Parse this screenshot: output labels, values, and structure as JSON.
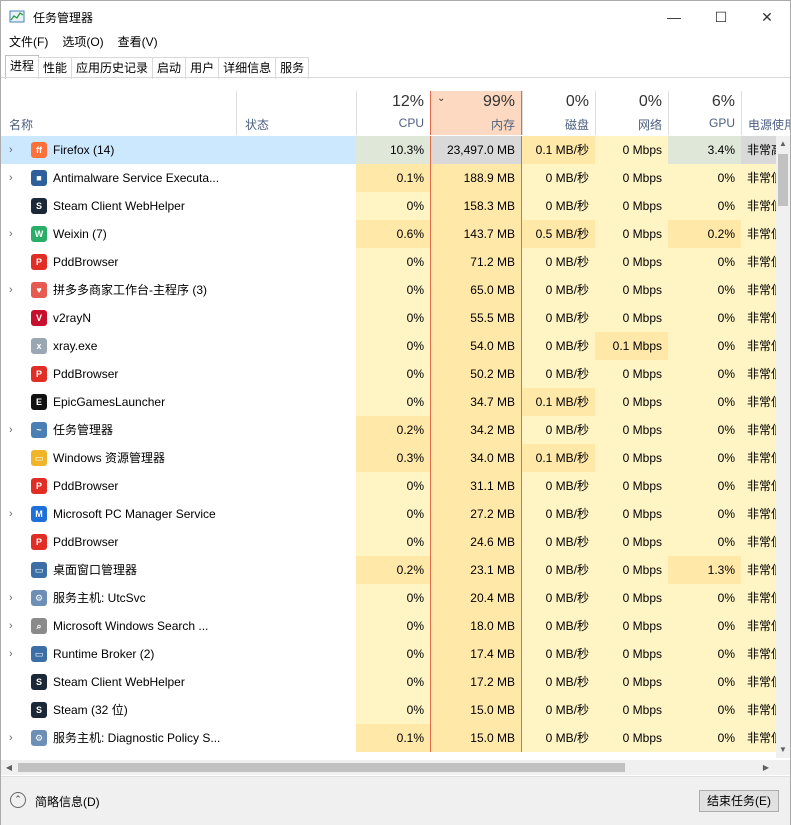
{
  "window": {
    "title": "任务管理器",
    "controls": {
      "minimize": "—",
      "maximize": "☐",
      "close": "✕"
    }
  },
  "menu": [
    "文件(F)",
    "选项(O)",
    "查看(V)"
  ],
  "tabs": [
    "进程",
    "性能",
    "应用历史记录",
    "启动",
    "用户",
    "详细信息",
    "服务"
  ],
  "header": {
    "name": "名称",
    "status": "状态",
    "cpu": {
      "pct": "12%",
      "label": "CPU"
    },
    "mem": {
      "pct": "99%",
      "label": "内存",
      "sort": "⌄"
    },
    "disk": {
      "pct": "0%",
      "label": "磁盘"
    },
    "net": {
      "pct": "0%",
      "label": "网络"
    },
    "gpu": {
      "pct": "6%",
      "label": "GPU"
    },
    "power": {
      "label": "电源使用"
    }
  },
  "processes": [
    {
      "name": "Firefox (14)",
      "expand": "›",
      "icon": "firefox-icon",
      "cpu": "10.3%",
      "mem": "23,497.0 MB",
      "disk": "0.1 MB/秒",
      "net": "0 Mbps",
      "gpu": "3.4%",
      "power": "非常高"
    },
    {
      "name": "Antimalware Service Executa...",
      "expand": "›",
      "icon": "antimalware-icon",
      "cpu": "0.1%",
      "mem": "188.9 MB",
      "disk": "0 MB/秒",
      "net": "0 Mbps",
      "gpu": "0%",
      "power": "非常低"
    },
    {
      "name": "Steam Client WebHelper",
      "expand": "",
      "icon": "steam-icon",
      "cpu": "0%",
      "mem": "158.3 MB",
      "disk": "0 MB/秒",
      "net": "0 Mbps",
      "gpu": "0%",
      "power": "非常低"
    },
    {
      "name": "Weixin (7)",
      "expand": "›",
      "icon": "weixin-icon",
      "cpu": "0.6%",
      "mem": "143.7 MB",
      "disk": "0.5 MB/秒",
      "net": "0 Mbps",
      "gpu": "0.2%",
      "power": "非常低"
    },
    {
      "name": "PddBrowser",
      "expand": "",
      "icon": "pddbrowser-icon",
      "cpu": "0%",
      "mem": "71.2 MB",
      "disk": "0 MB/秒",
      "net": "0 Mbps",
      "gpu": "0%",
      "power": "非常低"
    },
    {
      "name": "拼多多商家工作台-主程序 (3)",
      "expand": "›",
      "icon": "pdd-merchant-icon",
      "cpu": "0%",
      "mem": "65.0 MB",
      "disk": "0 MB/秒",
      "net": "0 Mbps",
      "gpu": "0%",
      "power": "非常低"
    },
    {
      "name": "v2rayN",
      "expand": "",
      "icon": "v2rayn-icon",
      "cpu": "0%",
      "mem": "55.5 MB",
      "disk": "0 MB/秒",
      "net": "0 Mbps",
      "gpu": "0%",
      "power": "非常低"
    },
    {
      "name": "xray.exe",
      "expand": "",
      "icon": "xray-icon",
      "cpu": "0%",
      "mem": "54.0 MB",
      "disk": "0 MB/秒",
      "net": "0.1 Mbps",
      "gpu": "0%",
      "power": "非常低"
    },
    {
      "name": "PddBrowser",
      "expand": "",
      "icon": "pddbrowser-icon",
      "cpu": "0%",
      "mem": "50.2 MB",
      "disk": "0 MB/秒",
      "net": "0 Mbps",
      "gpu": "0%",
      "power": "非常低"
    },
    {
      "name": "EpicGamesLauncher",
      "expand": "",
      "icon": "epic-icon",
      "cpu": "0%",
      "mem": "34.7 MB",
      "disk": "0.1 MB/秒",
      "net": "0 Mbps",
      "gpu": "0%",
      "power": "非常低"
    },
    {
      "name": "任务管理器",
      "expand": "›",
      "icon": "taskmgr-icon",
      "cpu": "0.2%",
      "mem": "34.2 MB",
      "disk": "0 MB/秒",
      "net": "0 Mbps",
      "gpu": "0%",
      "power": "非常低"
    },
    {
      "name": "Windows 资源管理器",
      "expand": "",
      "icon": "explorer-icon",
      "cpu": "0.3%",
      "mem": "34.0 MB",
      "disk": "0.1 MB/秒",
      "net": "0 Mbps",
      "gpu": "0%",
      "power": "非常低"
    },
    {
      "name": "PddBrowser",
      "expand": "",
      "icon": "pddbrowser-icon",
      "cpu": "0%",
      "mem": "31.1 MB",
      "disk": "0 MB/秒",
      "net": "0 Mbps",
      "gpu": "0%",
      "power": "非常低"
    },
    {
      "name": "Microsoft PC Manager Service",
      "expand": "›",
      "icon": "pcmanager-icon",
      "cpu": "0%",
      "mem": "27.2 MB",
      "disk": "0 MB/秒",
      "net": "0 Mbps",
      "gpu": "0%",
      "power": "非常低"
    },
    {
      "name": "PddBrowser",
      "expand": "",
      "icon": "pddbrowser-icon",
      "cpu": "0%",
      "mem": "24.6 MB",
      "disk": "0 MB/秒",
      "net": "0 Mbps",
      "gpu": "0%",
      "power": "非常低"
    },
    {
      "name": "桌面窗口管理器",
      "expand": "",
      "icon": "dwm-icon",
      "cpu": "0.2%",
      "mem": "23.1 MB",
      "disk": "0 MB/秒",
      "net": "0 Mbps",
      "gpu": "1.3%",
      "power": "非常低"
    },
    {
      "name": "服务主机: UtcSvc",
      "expand": "›",
      "icon": "service-gear-icon",
      "cpu": "0%",
      "mem": "20.4 MB",
      "disk": "0 MB/秒",
      "net": "0 Mbps",
      "gpu": "0%",
      "power": "非常低"
    },
    {
      "name": "Microsoft Windows Search ...",
      "expand": "›",
      "icon": "search-user-icon",
      "cpu": "0%",
      "mem": "18.0 MB",
      "disk": "0 MB/秒",
      "net": "0 Mbps",
      "gpu": "0%",
      "power": "非常低"
    },
    {
      "name": "Runtime Broker (2)",
      "expand": "›",
      "icon": "app-window-icon",
      "cpu": "0%",
      "mem": "17.4 MB",
      "disk": "0 MB/秒",
      "net": "0 Mbps",
      "gpu": "0%",
      "power": "非常低"
    },
    {
      "name": "Steam Client WebHelper",
      "expand": "",
      "icon": "steam-icon",
      "cpu": "0%",
      "mem": "17.2 MB",
      "disk": "0 MB/秒",
      "net": "0 Mbps",
      "gpu": "0%",
      "power": "非常低"
    },
    {
      "name": "Steam (32 位)",
      "expand": "",
      "icon": "steam-icon",
      "cpu": "0%",
      "mem": "15.0 MB",
      "disk": "0 MB/秒",
      "net": "0 Mbps",
      "gpu": "0%",
      "power": "非常低"
    },
    {
      "name": "服务主机: Diagnostic Policy S...",
      "expand": "›",
      "icon": "service-gear-icon",
      "cpu": "0.1%",
      "mem": "15.0 MB",
      "disk": "0 MB/秒",
      "net": "0 Mbps",
      "gpu": "0%",
      "power": "非常低"
    }
  ],
  "footer": {
    "less_details": "简略信息(D)",
    "less_icon": "⌃",
    "end_task": "结束任务(E)"
  },
  "scroll": {
    "up": "▲",
    "down": "▼",
    "left": "◀",
    "right": "▶"
  },
  "colors": {
    "selected": "#cce8ff",
    "sort_accent": "#e06a4a",
    "heat_low": "#fff4c4",
    "heat_mid": "#ffe8a8",
    "heat_high": "#ffdb80"
  }
}
